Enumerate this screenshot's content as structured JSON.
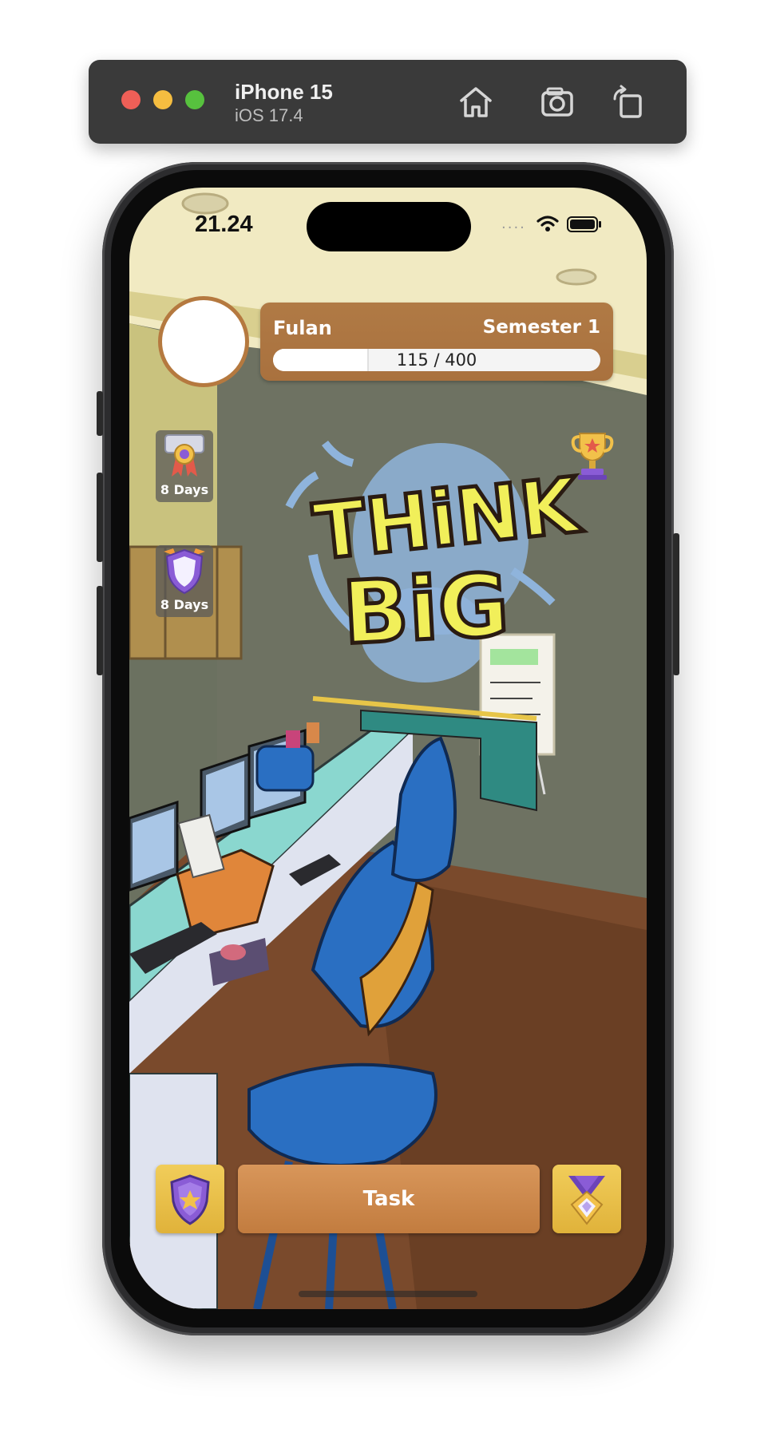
{
  "simulator": {
    "device_name": "iPhone 15",
    "os_version": "iOS 17.4",
    "toolbar_icons": [
      "home-icon",
      "screenshot-icon",
      "rotate-icon"
    ]
  },
  "status_bar": {
    "time": "21.24",
    "signal": "····",
    "icons": [
      "wifi-icon",
      "battery-icon"
    ]
  },
  "profile": {
    "name": "Fulan",
    "semester": "Semester 1",
    "xp_current": 115,
    "xp_max": 400,
    "xp_text": "115 / 400"
  },
  "streaks": [
    {
      "icon": "medal-icon",
      "label": "8 Days"
    },
    {
      "icon": "shield-icon",
      "label": "8 Days"
    }
  ],
  "scene": {
    "wall_text_line1": "THiNK",
    "wall_text_line2": "BiG"
  },
  "actions": {
    "left_icon": "badge-shield-icon",
    "task_label": "Task",
    "right_icon": "rank-medal-icon",
    "top_right_icon": "trophy-icon"
  },
  "colors": {
    "panel": "#b07a45",
    "task_button": "#c98543",
    "gold": "#e8c04a",
    "wall": "#6e7262",
    "floor": "#7a4a2c"
  }
}
